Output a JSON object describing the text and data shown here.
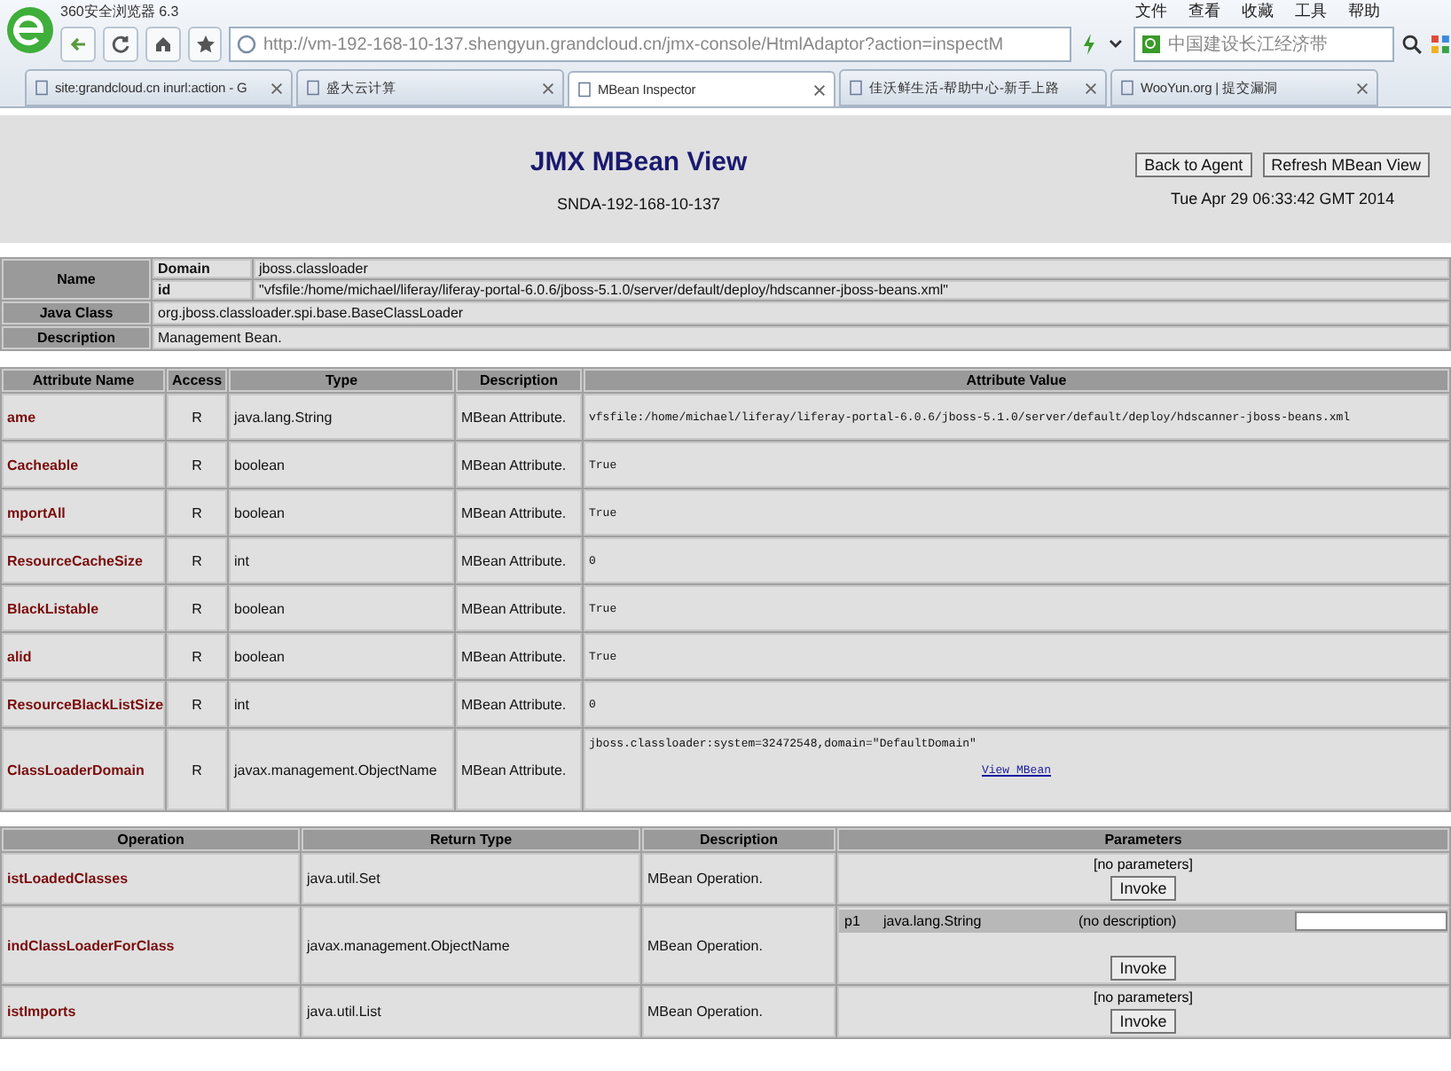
{
  "browser": {
    "title": "360安全浏览器 6.3",
    "menu": [
      "文件",
      "查看",
      "收藏",
      "工具",
      "帮助"
    ],
    "address": "http://vm-192-168-10-137.shengyun.grandcloud.cn/jmx-console/HtmlAdaptor?action=inspectM",
    "search": "中国建设长江经济带",
    "tabs": [
      {
        "label": "site:grandcloud.cn inurl:action - G",
        "selected": false
      },
      {
        "label": "盛大云计算",
        "selected": false
      },
      {
        "label": "MBean Inspector",
        "selected": true
      },
      {
        "label": "佳沃鲜生活-帮助中心-新手上路",
        "selected": false
      },
      {
        "label": "WooYun.org | 提交漏洞",
        "selected": false
      }
    ]
  },
  "header": {
    "title": "JMX MBean View",
    "host": "SNDA-192-168-10-137",
    "buttons": [
      "Back to Agent",
      "Refresh MBean View"
    ],
    "date": "Tue Apr 29 06:33:42 GMT 2014"
  },
  "summary": {
    "name_label": "Name",
    "domain_label": "Domain",
    "domain": "jboss.classloader",
    "id_label": "id",
    "id": "\"vfsfile:/home/michael/liferay/liferay-portal-6.0.6/jboss-5.1.0/server/default/deploy/hdscanner-jboss-beans.xml\"",
    "java_class_label": "Java Class",
    "java_class": "org.jboss.classloader.spi.base.BaseClassLoader",
    "description_label": "Description",
    "description": "Management Bean."
  },
  "attributes": {
    "columns": [
      "Attribute Name",
      "Access",
      "Type",
      "Description",
      "Attribute Value"
    ],
    "rows": [
      {
        "name": "ame",
        "access": "R",
        "type": "java.lang.String",
        "description": "MBean Attribute.",
        "value": "vfsfile:/home/michael/liferay/liferay-portal-6.0.6/jboss-5.1.0/server/default/deploy/hdscanner-jboss-beans.xml"
      },
      {
        "name": "Cacheable",
        "access": "R",
        "type": "boolean",
        "description": "MBean Attribute.",
        "value": "True"
      },
      {
        "name": "mportAll",
        "access": "R",
        "type": "boolean",
        "description": "MBean Attribute.",
        "value": "True"
      },
      {
        "name": "ResourceCacheSize",
        "access": "R",
        "type": "int",
        "description": "MBean Attribute.",
        "value": "0"
      },
      {
        "name": "BlackListable",
        "access": "R",
        "type": "boolean",
        "description": "MBean Attribute.",
        "value": "True"
      },
      {
        "name": "alid",
        "access": "R",
        "type": "boolean",
        "description": "MBean Attribute.",
        "value": "True"
      },
      {
        "name": "ResourceBlackListSize",
        "access": "R",
        "type": "int",
        "description": "MBean Attribute.",
        "value": "0"
      },
      {
        "name": "ClassLoaderDomain",
        "access": "R",
        "type": "javax.management.ObjectName",
        "description": "MBean Attribute.",
        "value": "jboss.classloader:system=32472548,domain=\"DefaultDomain\"",
        "link": "View MBean"
      }
    ]
  },
  "operations": {
    "columns": [
      "Operation",
      "Return Type",
      "Description",
      "Parameters"
    ],
    "rows": [
      {
        "name": "istLoadedClasses",
        "return_type": "java.util.Set",
        "description": "MBean Operation.",
        "no_parameters": "[no parameters]",
        "button": "Invoke"
      },
      {
        "name": "indClassLoaderForClass",
        "return_type": "javax.management.ObjectName",
        "description": "MBean Operation.",
        "parameters": [
          {
            "name": "p1",
            "type": "java.lang.String",
            "description": "(no description)"
          }
        ],
        "button": "Invoke"
      },
      {
        "name": "istImports",
        "return_type": "java.util.List",
        "description": "MBean Operation.",
        "no_parameters": "[no parameters]",
        "button": "Invoke"
      }
    ]
  }
}
